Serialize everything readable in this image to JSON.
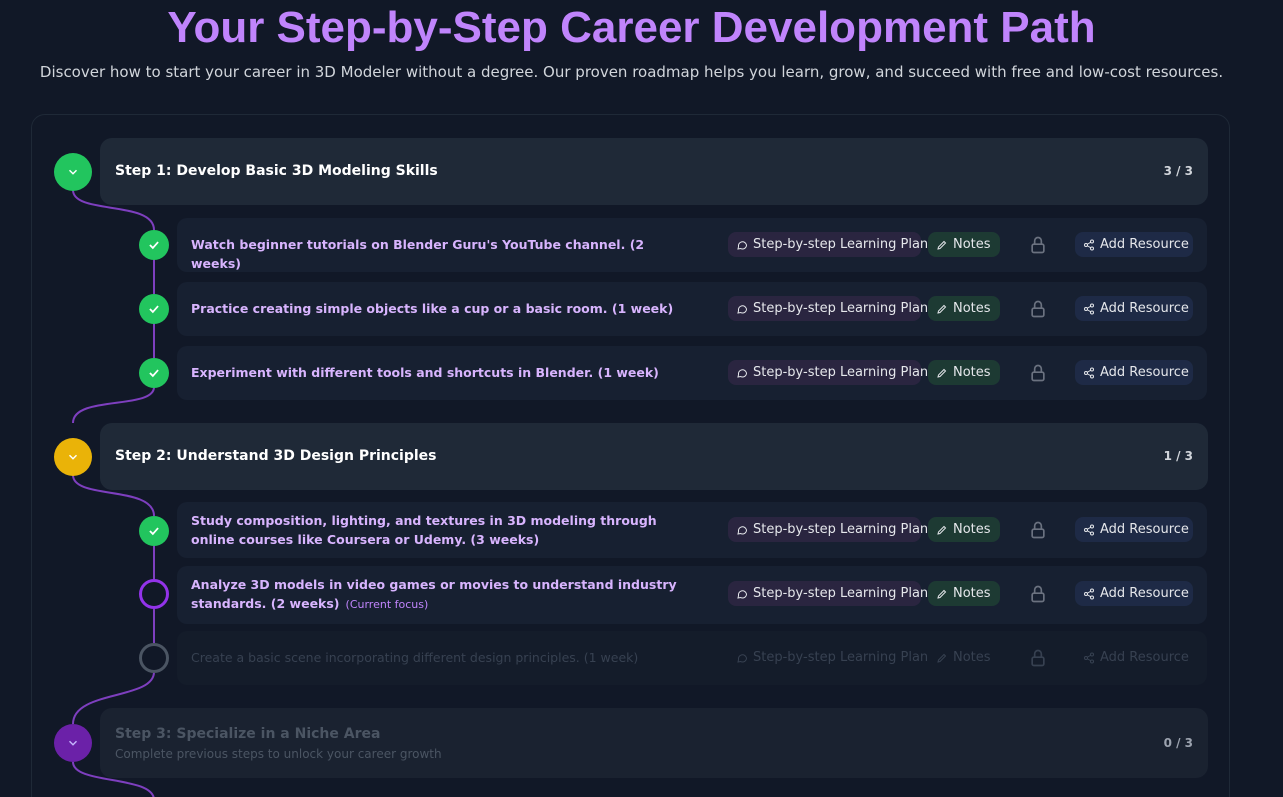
{
  "header": {
    "title": "Your Step-by-Step Career Development Path",
    "subtitle": "Discover how to start your career in 3D Modeler without a degree. Our proven roadmap helps you learn, grow, and succeed with free and low-cost resources."
  },
  "actions": {
    "plan_label": "Step-by-step Learning Plan",
    "notes_label": "Notes",
    "add_label": "Add Resource",
    "current_focus": "(Current focus)"
  },
  "colors": {
    "accent": "#c084fc",
    "done": "#22c55e",
    "in_progress": "#eab308",
    "locked": "#6b21a8",
    "connector": "#7e3fbf"
  },
  "steps": [
    {
      "title": "Step 1: Develop Basic 3D Modeling Skills",
      "progress": "3 / 3",
      "status": "done",
      "tasks": [
        {
          "text": "Watch beginner tutorials on Blender Guru's YouTube channel. (2 weeks)",
          "status": "done"
        },
        {
          "text": "Practice creating simple objects like a cup or a basic room. (1 week)",
          "status": "done"
        },
        {
          "text": "Experiment with different tools and shortcuts in Blender. (1 week)",
          "status": "done"
        }
      ]
    },
    {
      "title": "Step 2: Understand 3D Design Principles",
      "progress": "1 / 3",
      "status": "in-progress",
      "tasks": [
        {
          "text": "Study composition, lighting, and textures in 3D modeling through online courses like Coursera or Udemy. (3 weeks)",
          "status": "done"
        },
        {
          "text": "Analyze 3D models in video games or movies to understand industry standards. (2 weeks)",
          "status": "current"
        },
        {
          "text": "Create a basic scene incorporating different design principles. (1 week)",
          "status": "pending"
        }
      ]
    },
    {
      "title": "Step 3: Specialize in a Niche Area",
      "subtitle": "Complete previous steps to unlock your career growth",
      "progress": "0 / 3",
      "status": "locked"
    }
  ]
}
